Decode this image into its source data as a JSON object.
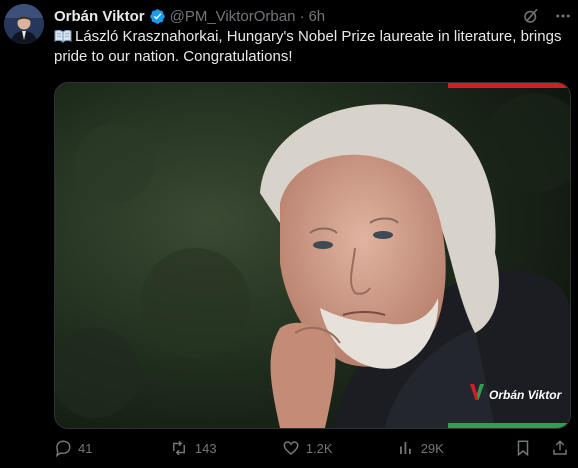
{
  "author": {
    "name": "Orbán Viktor",
    "handle": "@PM_ViktorOrban",
    "separator": "·",
    "time": "6h",
    "verified": true
  },
  "tweet": {
    "emoji_icon": "open-book-icon",
    "text": "László Krasznahorkai, Hungary's Nobel Prize laureate in literature, brings pride to our nation. Congratulations!"
  },
  "media": {
    "watermark_text": "Orbán Viktor",
    "flag_colors": [
      "#d11f2a",
      "#ffffff",
      "#2e9e50"
    ]
  },
  "actions": {
    "replies": "41",
    "reposts": "143",
    "likes": "1.2K",
    "views": "29K"
  },
  "colors": {
    "background": "#000000",
    "text": "#e7e9ea",
    "muted": "#71767b",
    "verified": "#1d9bf0"
  }
}
